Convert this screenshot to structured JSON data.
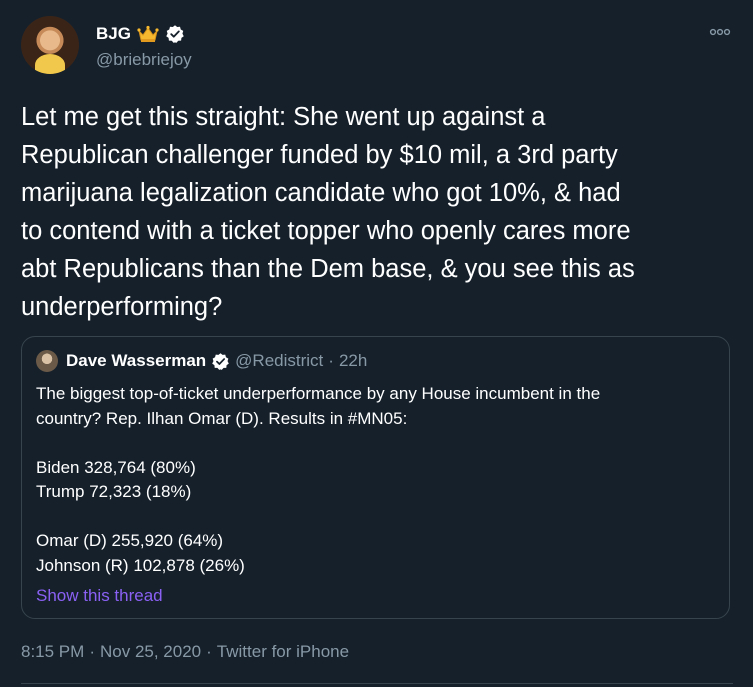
{
  "author": {
    "display_name": "BJG",
    "handle": "@briebriejoy"
  },
  "tweet": {
    "text": "Let me get this straight: She went up against a\nRepublican challenger funded by $10 mil, a 3rd party\nmarijuana legalization candidate who got 10%, & had\nto contend with a ticket topper who openly cares more\nabt Republicans than the Dem base, & you see this as\nunderperforming?"
  },
  "quote": {
    "display_name": "Dave Wasserman",
    "handle": "@Redistrict",
    "separator": "·",
    "time": "22h",
    "text": "The biggest top-of-ticket underperformance by any House incumbent in the\ncountry? Rep. Ilhan Omar (D). Results in #MN05:\n\nBiden 328,764 (80%)\nTrump 72,323 (18%)\n\nOmar (D) 255,920 (64%)\nJohnson (R) 102,878 (26%)",
    "show_thread_label": "Show this thread"
  },
  "meta": {
    "time": "8:15 PM",
    "separator": "·",
    "date": "Nov 25, 2020",
    "source": "Twitter for iPhone"
  },
  "colors": {
    "background": "#15202b",
    "text": "#ffffff",
    "secondary": "#8899a6",
    "border": "#38444d",
    "link": "#8b61f4",
    "verified": "#ffffff"
  },
  "icons": {
    "author_badge": "crown-emoji",
    "verified": "verified-badge-icon",
    "more": "more-horizontal-icon"
  }
}
